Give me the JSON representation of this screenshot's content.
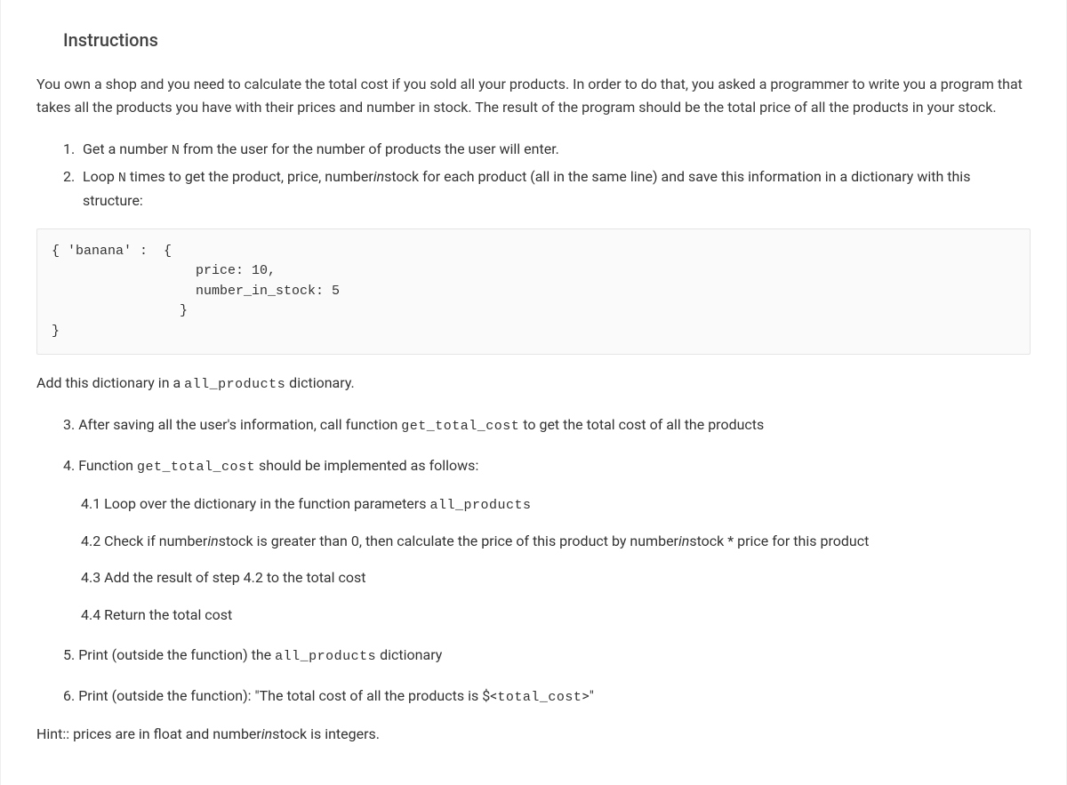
{
  "heading": "Instructions",
  "intro": "You own a shop and you need to calculate the total cost if you sold all your products. In order to do that, you asked a programmer to write you a program that takes all the products you have with their prices and number in stock. The result of the program should be the total price of all the products in your stock.",
  "step1_num": "1.",
  "step1_a": "Get a number ",
  "step1_code": "N",
  "step1_b": " from the user for the number of products the user will enter.",
  "step2_num": "2.",
  "step2_a": "Loop ",
  "step2_code": "N",
  "step2_b": " times to get the product, price, number",
  "step2_italic1": "in",
  "step2_c": "stock for each product (all in the same line) and save this information in a dictionary with this structure:",
  "code_block": "{ 'banana' :  {\n                  price: 10,\n                  number_in_stock: 5\n                }\n}",
  "after_code_a": "Add this dictionary in a ",
  "after_code_code": "all_products",
  "after_code_b": " dictionary.",
  "step3_num": "3.",
  "step3_a": "After saving all the user's information, call function ",
  "step3_code": "get_total_cost",
  "step3_b": " to get the total cost of all the products",
  "step4_num": "4.",
  "step4_a": "Function ",
  "step4_code": "get_total_cost",
  "step4_b": " should be implemented as follows:",
  "step41_num": "4.1",
  "step41_a": "Loop over the dictionary in the function parameters ",
  "step41_code": "all_products",
  "step42_num": "4.2",
  "step42_a": "Check if number",
  "step42_italic1": "in",
  "step42_b": "stock is greater than 0, then calculate the price of this product by number",
  "step42_italic2": "in",
  "step42_c": "stock * price for this product",
  "step43_num": "4.3",
  "step43_a": "Add the result of step 4.2 to the total cost",
  "step44_num": "4.4",
  "step44_a": "Return the total cost",
  "step5_num": "5.",
  "step5_a": "Print (outside the function) the ",
  "step5_code": "all_products",
  "step5_b": " dictionary",
  "step6_num": "6.",
  "step6_a": "Print (outside the function): \"The total cost of all the products is $<",
  "step6_code": "total_cost",
  "step6_b": ">\"",
  "hint_a": "Hint:: prices are in float and number",
  "hint_italic": "in",
  "hint_b": "stock is integers."
}
